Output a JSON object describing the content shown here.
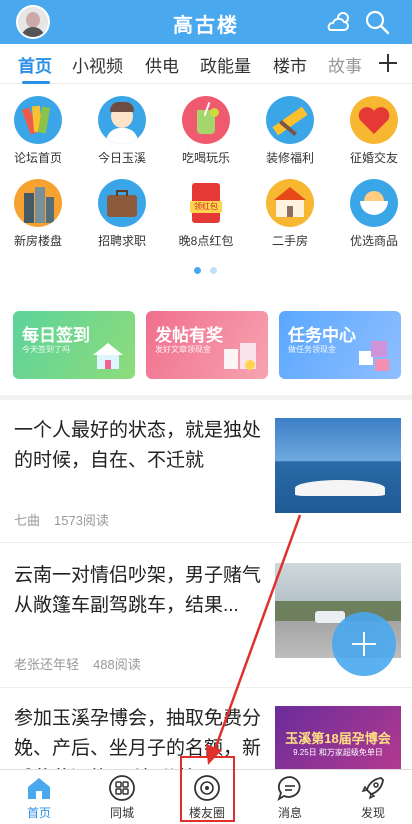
{
  "header": {
    "title": "高古楼",
    "avatar_icon": "avatar-icon",
    "weather_icon": "weather-cloud-icon",
    "search_icon": "search-icon"
  },
  "tabs": [
    {
      "label": "首页",
      "active": true
    },
    {
      "label": "小视频"
    },
    {
      "label": "供电"
    },
    {
      "label": "政能量"
    },
    {
      "label": "楼市"
    },
    {
      "label": "故事"
    }
  ],
  "grid": [
    {
      "label": "论坛首页",
      "icon": "color-swatch-icon"
    },
    {
      "label": "今日玉溪",
      "icon": "person-icon"
    },
    {
      "label": "吃喝玩乐",
      "icon": "drink-icon"
    },
    {
      "label": "装修福利",
      "icon": "ruler-icon"
    },
    {
      "label": "征婚交友",
      "icon": "heart-icon"
    },
    {
      "label": "新房楼盘",
      "icon": "building-icon"
    },
    {
      "label": "招聘求职",
      "icon": "briefcase-icon"
    },
    {
      "label": "晚8点红包",
      "icon": "red-envelope-icon",
      "badge": "领红包"
    },
    {
      "label": "二手房",
      "icon": "house-icon"
    },
    {
      "label": "优选商品",
      "icon": "bowl-icon"
    }
  ],
  "banners": [
    {
      "title": "每日签到",
      "subtitle": "今天签到了吗"
    },
    {
      "title": "发帖有奖",
      "subtitle": "发好文章领现金"
    },
    {
      "title": "任务中心",
      "subtitle": "做任务领现金"
    }
  ],
  "articles": [
    {
      "title": "一个人最好的状态，就是独处的时候，自在、不迁就",
      "author": "七曲",
      "reads": "1573阅读"
    },
    {
      "title": "云南一对情侣吵架，男子赌气从敞篷车副驾跳车，结果...",
      "author": "老张还年轻",
      "reads": "488阅读"
    },
    {
      "title": "参加玉溪孕博会，抽取免费分娩、产后、坐月子的名额，新手爸爸还能“预演”分娩",
      "thumb_text_1": "玉溪第18届孕博会",
      "thumb_text_2": "9.25日 和万家超级免单日"
    }
  ],
  "bottom_nav": [
    {
      "label": "首页",
      "icon": "home-icon",
      "active": true
    },
    {
      "label": "同城",
      "icon": "grid-apps-icon"
    },
    {
      "label": "楼友圈",
      "icon": "camera-lens-icon"
    },
    {
      "label": "消息",
      "icon": "message-icon"
    },
    {
      "label": "发现",
      "icon": "rocket-icon"
    }
  ],
  "colors": {
    "brand": "#4aa8ef",
    "active_tab": "#2a8fe6",
    "annotation": "#e0302c"
  }
}
